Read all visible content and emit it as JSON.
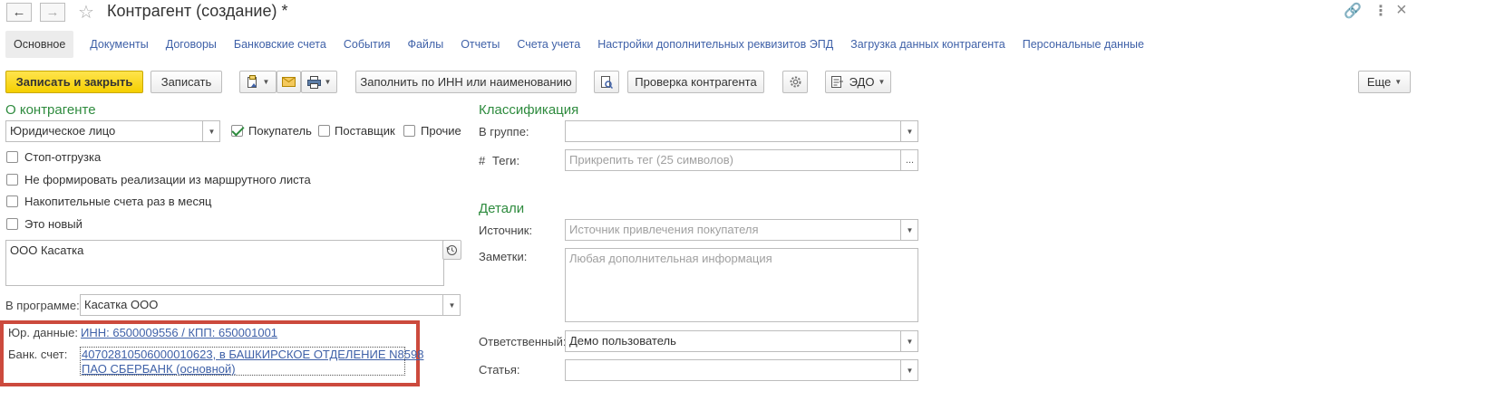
{
  "window": {
    "title": "Контрагент (создание) *",
    "back_icon": "←",
    "forward_icon": "→",
    "star_icon": "☆",
    "link_icon": "🔗",
    "more_icon": "⋮",
    "close_icon": "×"
  },
  "tabs": [
    {
      "label": "Основное",
      "active": true
    },
    {
      "label": "Документы"
    },
    {
      "label": "Договоры"
    },
    {
      "label": "Банковские счета"
    },
    {
      "label": "События"
    },
    {
      "label": "Файлы"
    },
    {
      "label": "Отчеты"
    },
    {
      "label": "Счета учета"
    },
    {
      "label": "Настройки дополнительных реквизитов ЭПД"
    },
    {
      "label": "Загрузка данных контрагента"
    },
    {
      "label": "Персональные данные"
    }
  ],
  "toolbar": {
    "save_close": "Записать и закрыть",
    "save": "Записать",
    "fill_inn": "Заполнить по ИНН или наименованию",
    "check": "Проверка контрагента",
    "edo": "ЭДО",
    "more": "Еще"
  },
  "left": {
    "section_title": "О контрагенте",
    "entity_type": "Юридическое лицо",
    "buyer": "Покупатель",
    "supplier": "Поставщик",
    "other": "Прочие",
    "stop_shipment": "Стоп-отгрузка",
    "no_route_sales": "Не формировать реализации из маршрутного листа",
    "monthly_invoices": "Накопительные счета раз в месяц",
    "is_new": "Это новый",
    "full_name": "ООО Касатка",
    "in_program_label": "В программе:",
    "in_program_value": "Касатка ООО",
    "legal_label": "Юр. данные:",
    "legal_value": "ИНН: 6500009556 / КПП: 650001001",
    "bank_label": "Банк. счет:",
    "bank_line1": "40702810506000010623, в БАШКИРСКОЕ ОТДЕЛЕНИЕ N8598",
    "bank_line2": "ПАО СБЕРБАНК (основной)"
  },
  "right": {
    "classification_title": "Классификация",
    "group_label": "В группе:",
    "group_value": "",
    "tags_hash": "#",
    "tags_label": "Теги:",
    "tags_placeholder": "Прикрепить тег (25 символов)",
    "details_title": "Детали",
    "source_label": "Источник:",
    "source_placeholder": "Источник привлечения покупателя",
    "notes_label": "Заметки:",
    "notes_placeholder": "Любая дополнительная информация",
    "responsible_label": "Ответственный:",
    "responsible_value": "Демо пользователь",
    "article_label": "Статья:",
    "article_value": ""
  },
  "colors": {
    "primary_button": "#f5cf00",
    "section_header": "#2e8b3e",
    "link": "#3f61a8",
    "highlight_box": "#cc4a3d"
  }
}
